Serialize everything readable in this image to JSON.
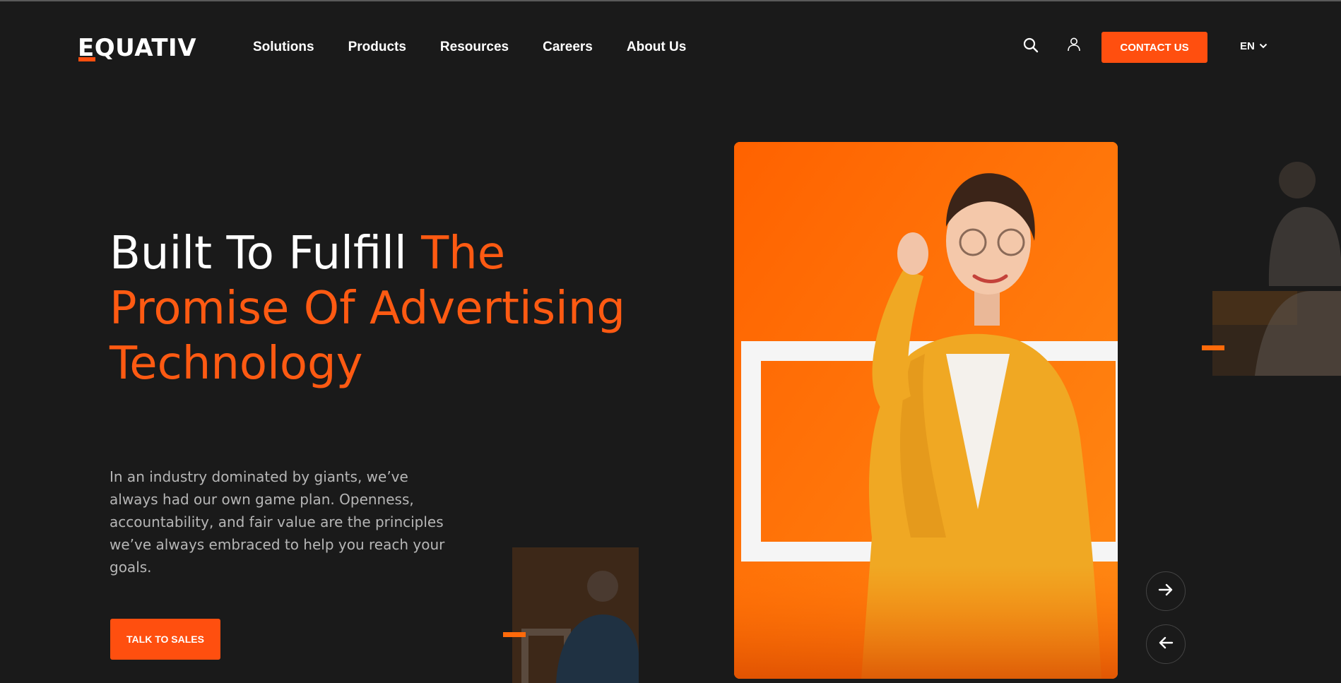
{
  "brand": {
    "logo_text": "EQUATIV",
    "accent": "#ff4f0f",
    "background": "#1a1a1a"
  },
  "nav": {
    "items": [
      {
        "label": "Solutions"
      },
      {
        "label": "Products"
      },
      {
        "label": "Resources"
      },
      {
        "label": "Careers"
      },
      {
        "label": "About Us"
      }
    ]
  },
  "header": {
    "search_icon": "search-icon",
    "account_icon": "user-icon",
    "contact_label": "CONTACT US",
    "language": "EN",
    "language_icon": "chevron-down-icon"
  },
  "hero": {
    "headline_white": "Built To Fulfill ",
    "headline_orange_1": "The",
    "headline_orange_2": "Promise Of Advertising",
    "headline_orange_3": "Technology",
    "description": "In an industry dominated by giants, we’ve always had our own game plan. Openness, accountability, and fair value are the principles we’ve always embraced to help you reach your goals.",
    "cta_label": "TALK TO SALES"
  },
  "carousel": {
    "next_icon": "arrow-right-icon",
    "prev_icon": "arrow-left-icon"
  }
}
